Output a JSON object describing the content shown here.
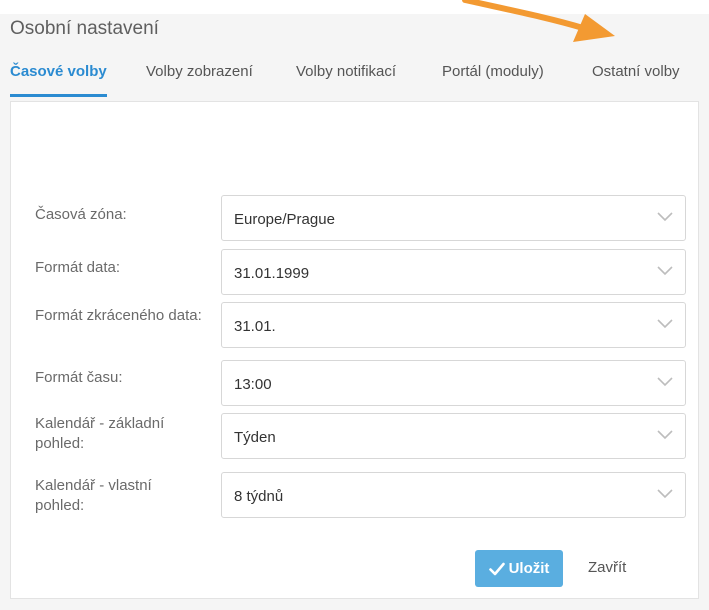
{
  "header": {
    "title": "Osobní nastavení"
  },
  "tabs": [
    {
      "label": "Časové volby",
      "active": true
    },
    {
      "label": "Volby zobrazení",
      "active": false
    },
    {
      "label": "Volby notifikací",
      "active": false
    },
    {
      "label": "Portál (moduly)",
      "active": false
    },
    {
      "label": "Ostatní volby",
      "active": false
    }
  ],
  "form": {
    "fields": [
      {
        "label": "Časová zóna:",
        "value": "Europe/Prague"
      },
      {
        "label": "Formát data:",
        "value": "31.01.1999"
      },
      {
        "label": "Formát zkráceného data:",
        "value": "31.01."
      },
      {
        "label": "Formát času:",
        "value": "13:00"
      },
      {
        "label": "Kalendář - základní pohled:",
        "value": "Týden"
      },
      {
        "label": "Kalendář - vlastní pohled:",
        "value": "8 týdnů"
      }
    ]
  },
  "actions": {
    "save_label": "Uložit",
    "close_label": "Zavřít"
  },
  "colors": {
    "accent": "#2b8bd1",
    "save_button": "#5aaee0",
    "annotation_arrow": "#f39a32"
  },
  "icons": {
    "select_chevron": "chevron-down-icon",
    "save_check": "check-icon"
  }
}
